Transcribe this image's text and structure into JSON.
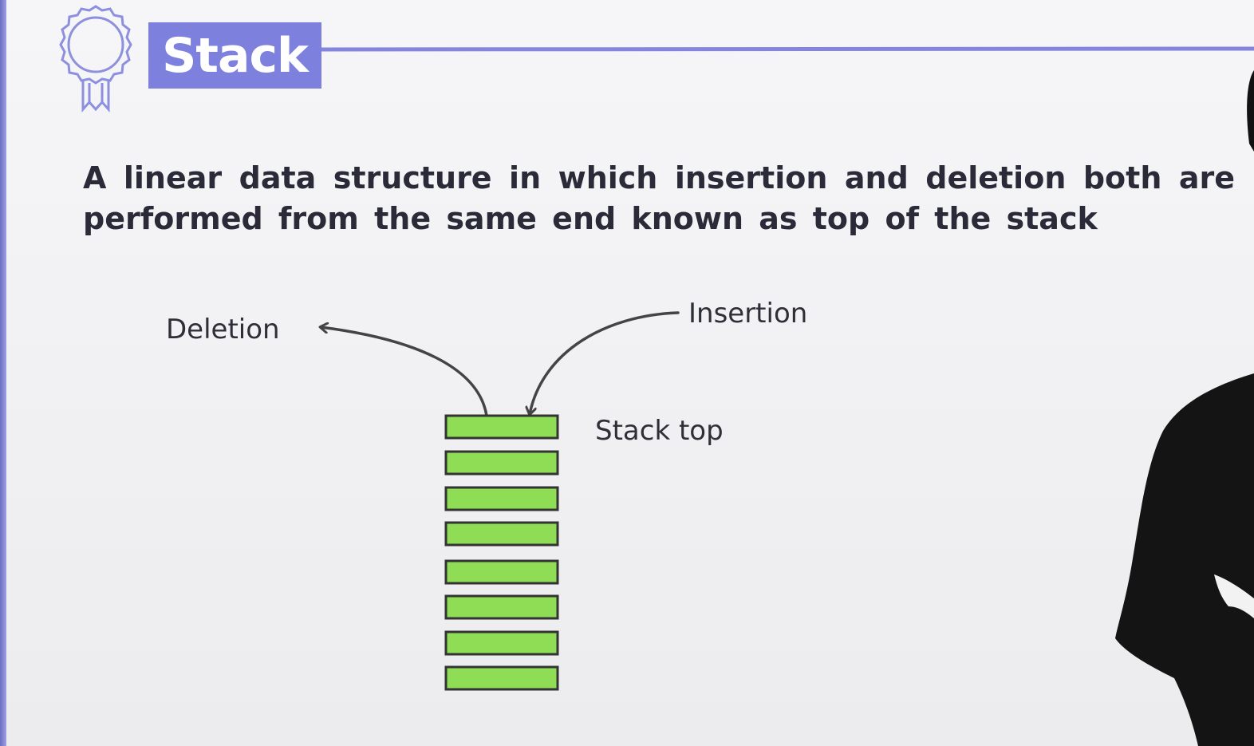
{
  "slide": {
    "title": "Stack",
    "definition": "A linear data structure in which insertion and deletion both are performed from the same end known as top of the stack"
  },
  "diagram": {
    "labels": {
      "deletion": "Deletion",
      "insertion": "Insertion",
      "stack_top": "Stack top"
    },
    "stack_element_count": 8
  },
  "colors": {
    "accent": "#7d80dc",
    "stack_fill": "#8fdc55",
    "stack_border": "#333333",
    "text": "#2a2a38"
  },
  "icons": {
    "badge": "award-ribbon-icon"
  }
}
